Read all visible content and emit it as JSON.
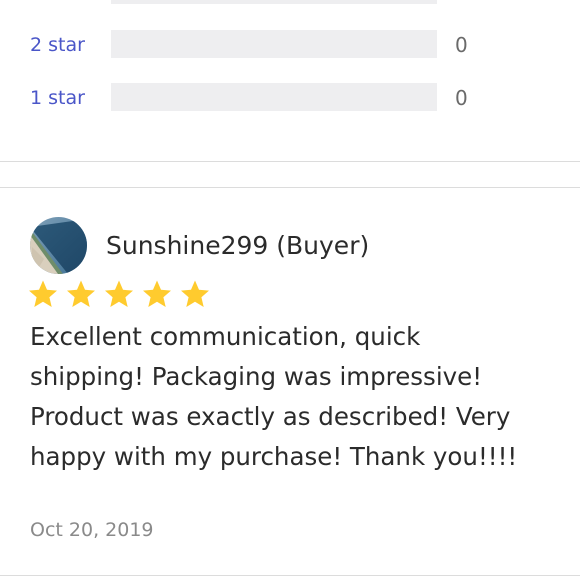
{
  "rating_breakdown": [
    {
      "label": "2 star",
      "count": "0",
      "fraction": 0
    },
    {
      "label": "1 star",
      "count": "0",
      "fraction": 0
    }
  ],
  "review": {
    "avatar_icon": "beach-photo-avatar",
    "reviewer": "Sunshine299 (Buyer)",
    "rating": 5,
    "rating_max": 5,
    "star_color": "#ffcb2e",
    "text_lines": [
      "Excellent communication, quick",
      "shipping! Packaging was impressive!",
      "Product was exactly as described! Very",
      "happy with my purchase! Thank you!!!!"
    ],
    "date": "Oct 20, 2019"
  },
  "colors": {
    "accent": "#4a56c8",
    "bar_track": "#eeeef0",
    "divider": "#dcdcdc"
  }
}
